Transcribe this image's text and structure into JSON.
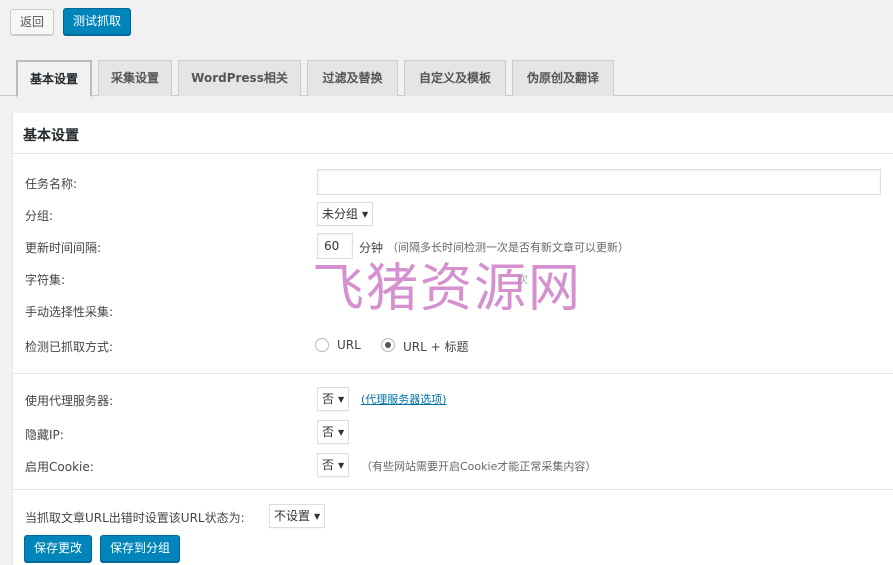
{
  "toolbar": {
    "back_label": "返回",
    "test_label": "测试抓取"
  },
  "tabs": [
    {
      "label": "基本设置"
    },
    {
      "label": "采集设置"
    },
    {
      "label": "WordPress相关"
    },
    {
      "label": "过滤及替换"
    },
    {
      "label": "自定义及模板"
    },
    {
      "label": "伪原创及翻译"
    }
  ],
  "panel": {
    "title": "基本设置"
  },
  "form": {
    "task_name": {
      "label": "任务名称:",
      "value": ""
    },
    "group": {
      "label": "分组:",
      "value": "未分组"
    },
    "interval": {
      "label": "更新时间间隔:",
      "value": "60",
      "unit": "分钟",
      "note": "（间隔多长时间检测一次是否有新文章可以更新）"
    },
    "charset": {
      "label": "字符集:",
      "note": "次"
    },
    "manual": {
      "label": "手动选择性采集:"
    },
    "detect": {
      "label": "检测已抓取方式:",
      "option1": "URL",
      "option2": "URL + 标题"
    },
    "proxy": {
      "label": "使用代理服务器:",
      "value": "否",
      "link": "(代理服务器选项)"
    },
    "hide_ip": {
      "label": "隐藏IP:",
      "value": "否"
    },
    "cookie": {
      "label": "启用Cookie:",
      "value": "否",
      "note": "（有些网站需要开启Cookie才能正常采集内容）"
    },
    "error_status": {
      "label": "当抓取文章URL出错时设置该URL状态为:",
      "value": "不设置"
    }
  },
  "actions": {
    "save_label": "保存更改",
    "save_group_label": "保存到分组"
  },
  "watermark": "飞猪资源网"
}
